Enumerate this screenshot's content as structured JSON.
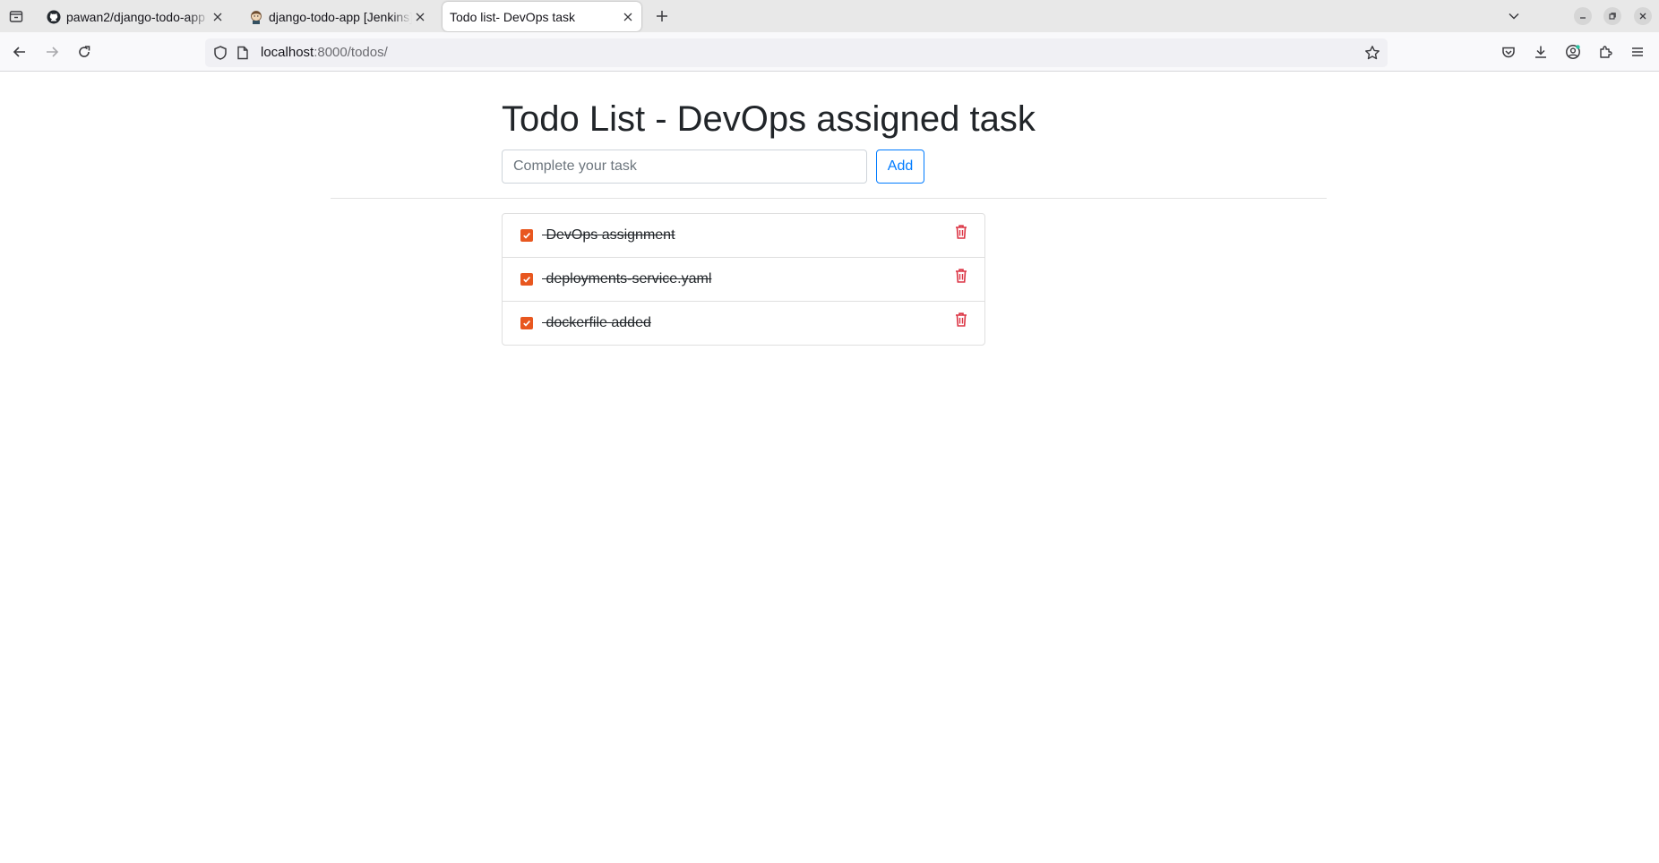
{
  "browser": {
    "tabs": [
      {
        "title": "pawan2/django-todo-app",
        "favicon": "github-icon",
        "active": false
      },
      {
        "title": "django-todo-app [Jenkins]",
        "favicon": "jenkins-icon",
        "active": false
      },
      {
        "title": "Todo list- DevOps task",
        "favicon": "",
        "active": true
      }
    ],
    "url": {
      "host": "localhost",
      "path": ":8000/todos/"
    }
  },
  "page": {
    "heading": "Todo List - DevOps assigned task",
    "input": {
      "placeholder": "Complete your task",
      "value": ""
    },
    "add_label": "Add",
    "todos": [
      {
        "text": "DevOps assignment",
        "completed": true
      },
      {
        "text": "deployments-service.yaml",
        "completed": true
      },
      {
        "text": "dockerfile added",
        "completed": true
      }
    ]
  },
  "colors": {
    "checkbox": "#e8571f",
    "trash": "#dc3545",
    "primary": "#007bff",
    "heading": "#212529"
  }
}
